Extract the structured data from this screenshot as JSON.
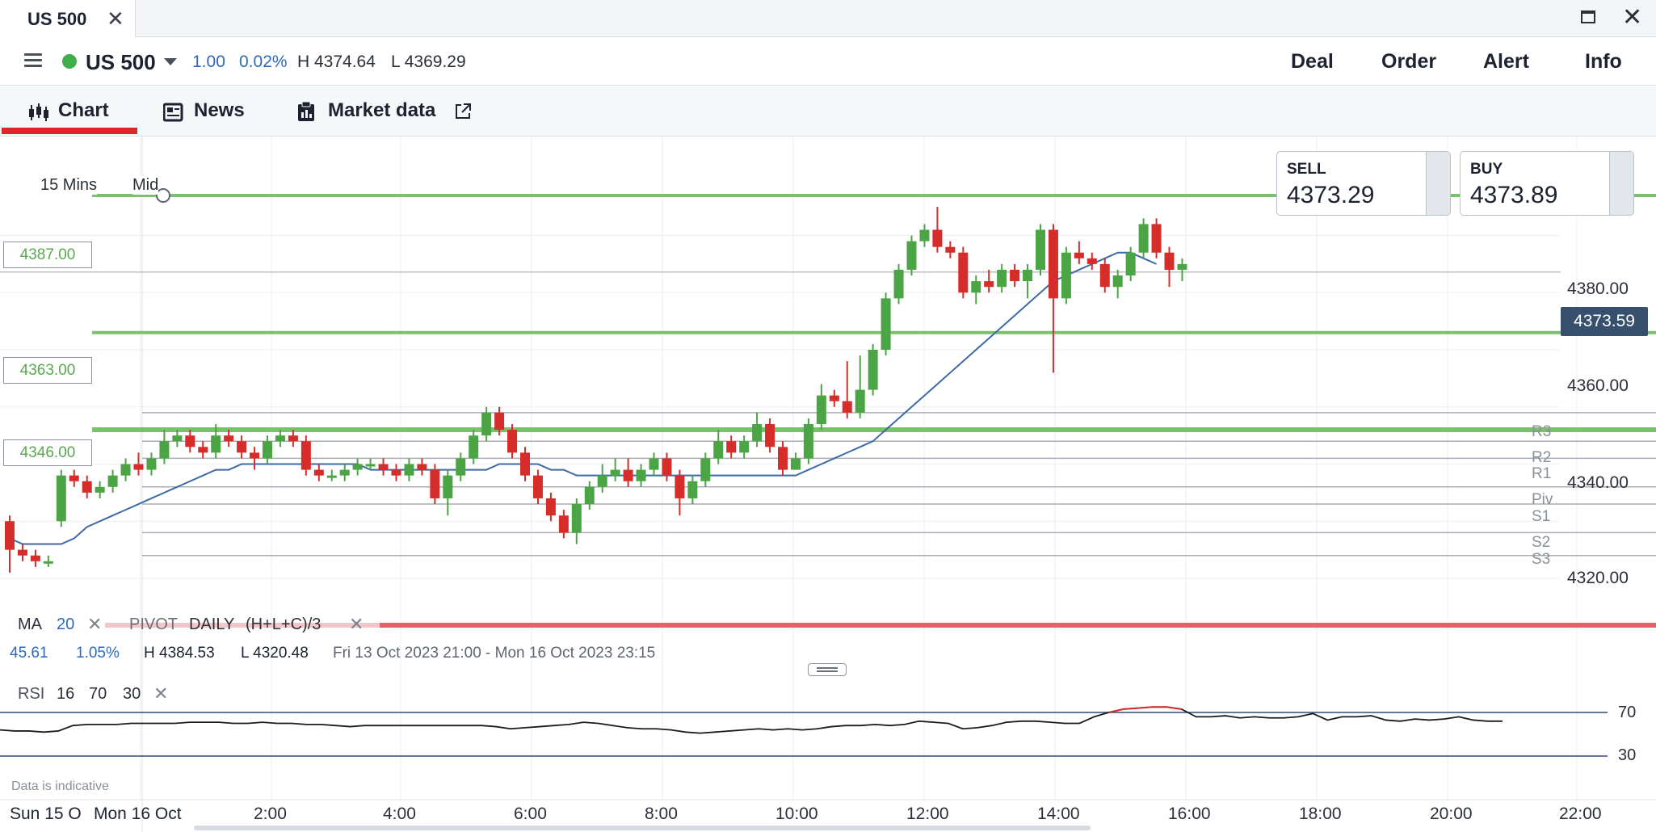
{
  "window": {
    "tab_title": "US 500",
    "close_glyph": "✕",
    "maximize_icon": "maximize-icon",
    "window_close_glyph": "✕"
  },
  "instrument": {
    "name": "US 500",
    "status_color": "#3fae49",
    "change_abs": "1.00",
    "change_pct": "0.02%",
    "high": "H 4374.64",
    "low": "L 4369.29",
    "buttons": [
      "Deal",
      "Order",
      "Alert",
      "Info"
    ]
  },
  "tabs": {
    "chart": "Chart",
    "news": "News",
    "market_data": "Market data",
    "active": "Chart",
    "accent_color": "#e0262c"
  },
  "chart": {
    "timeframe": "15 Mins",
    "price_type": "Mid",
    "sell": {
      "label": "SELL",
      "price": "4373.29"
    },
    "buy": {
      "label": "BUY",
      "price": "4373.89"
    },
    "current_price": "4373.59",
    "horizontal_levels": [
      "4387.00",
      "4363.00",
      "4346.00"
    ],
    "pivot_labels": [
      "R3",
      "R2",
      "R1",
      "Piv",
      "S1",
      "S2",
      "S3"
    ],
    "y_axis_labels": [
      "4380.00",
      "4360.00",
      "4340.00",
      "4320.00"
    ],
    "x_axis_labels": [
      "2:00",
      "4:00",
      "6:00",
      "8:00",
      "10:00",
      "12:00",
      "14:00",
      "16:00",
      "18:00",
      "20:00",
      "22:00"
    ],
    "date_labels": [
      "Sun 15 O",
      "Mon 16 Oct"
    ],
    "colors": {
      "up": "#4ca545",
      "down": "#d62d2a",
      "ma": "#3d6aa6",
      "level": "#7cbf6f",
      "pivot": "#a9aeb6",
      "rsi": "#1c1c1c",
      "rsi_over": "#d62d2a"
    }
  },
  "indicators": {
    "ma_label": "MA",
    "ma_period": "20",
    "pivot_label": "PIVOT",
    "pivot_period": "DAILY",
    "pivot_formula": "(H+L+C)/3",
    "remove_glyph": "✕"
  },
  "stats": {
    "change_abs": "45.61",
    "change_pct": "1.05%",
    "high": "H 4384.53",
    "low": "L 4320.48",
    "range": "Fri 13 Oct 2023 21:00 - Mon 16 Oct 2023 23:15"
  },
  "rsi": {
    "label": "RSI",
    "period": "16",
    "upper": "70",
    "lower": "30",
    "axis_upper": "70",
    "axis_lower": "30"
  },
  "disclaimer": "Data is indicative",
  "chart_data": {
    "type": "candlestick",
    "title": "",
    "ylabel": "",
    "xlabel": "",
    "ylim": [
      4315,
      4392
    ],
    "y_ticks": [
      4320,
      4340,
      4360,
      4380
    ],
    "x_ticks": [
      "2:00",
      "4:00",
      "6:00",
      "8:00",
      "10:00",
      "12:00",
      "14:00",
      "16:00",
      "18:00",
      "20:00",
      "22:00"
    ],
    "grid": true,
    "candles": [
      [
        4330,
        4325,
        4331,
        4321
      ],
      [
        4325,
        4324,
        4326,
        4323
      ],
      [
        4324,
        4323,
        4325,
        4322
      ],
      [
        4323,
        4323,
        4324,
        4322
      ],
      [
        4330,
        4338,
        4339,
        4329
      ],
      [
        4338,
        4337,
        4339,
        4336
      ],
      [
        4337,
        4335,
        4338,
        4334
      ],
      [
        4335,
        4336,
        4337,
        4334
      ],
      [
        4336,
        4338,
        4339,
        4335
      ],
      [
        4338,
        4340,
        4341,
        4337
      ],
      [
        4340,
        4339,
        4342,
        4338
      ],
      [
        4339,
        4341,
        4342,
        4338
      ],
      [
        4341,
        4344,
        4346,
        4340
      ],
      [
        4344,
        4345,
        4346,
        4343
      ],
      [
        4345,
        4343,
        4346,
        4342
      ],
      [
        4343,
        4342,
        4344,
        4341
      ],
      [
        4342,
        4345,
        4347,
        4341
      ],
      [
        4345,
        4344,
        4346,
        4343
      ],
      [
        4344,
        4342,
        4345,
        4341
      ],
      [
        4342,
        4341,
        4343,
        4339
      ],
      [
        4341,
        4344,
        4345,
        4340
      ],
      [
        4344,
        4345,
        4346,
        4343
      ],
      [
        4345,
        4344,
        4346,
        4343
      ],
      [
        4344,
        4339,
        4345,
        4338
      ],
      [
        4339,
        4338,
        4340,
        4337
      ],
      [
        4338,
        4338,
        4339,
        4337
      ],
      [
        4338,
        4339,
        4340,
        4337
      ],
      [
        4339,
        4340,
        4341,
        4338
      ],
      [
        4340,
        4340,
        4341,
        4339
      ],
      [
        4340,
        4339,
        4341,
        4338
      ],
      [
        4339,
        4338,
        4340,
        4337
      ],
      [
        4338,
        4340,
        4341,
        4337
      ],
      [
        4340,
        4339,
        4341,
        4338
      ],
      [
        4339,
        4334,
        4340,
        4333
      ],
      [
        4334,
        4338,
        4339,
        4331
      ],
      [
        4338,
        4341,
        4342,
        4337
      ],
      [
        4341,
        4345,
        4346,
        4340
      ],
      [
        4345,
        4349,
        4350,
        4344
      ],
      [
        4349,
        4346,
        4350,
        4345
      ],
      [
        4346,
        4342,
        4347,
        4341
      ],
      [
        4342,
        4338,
        4343,
        4337
      ],
      [
        4338,
        4334,
        4339,
        4333
      ],
      [
        4334,
        4331,
        4335,
        4330
      ],
      [
        4331,
        4328,
        4332,
        4327
      ],
      [
        4328,
        4333,
        4334,
        4326
      ],
      [
        4333,
        4336,
        4337,
        4332
      ],
      [
        4336,
        4338,
        4340,
        4335
      ],
      [
        4338,
        4339,
        4341,
        4337
      ],
      [
        4339,
        4337,
        4341,
        4336
      ],
      [
        4337,
        4339,
        4340,
        4336
      ],
      [
        4339,
        4341,
        4342,
        4338
      ],
      [
        4341,
        4338,
        4342,
        4337
      ],
      [
        4338,
        4334,
        4339,
        4331
      ],
      [
        4334,
        4337,
        4338,
        4333
      ],
      [
        4337,
        4341,
        4342,
        4336
      ],
      [
        4341,
        4344,
        4346,
        4340
      ],
      [
        4344,
        4342,
        4345,
        4341
      ],
      [
        4342,
        4344,
        4345,
        4341
      ],
      [
        4344,
        4347,
        4349,
        4343
      ],
      [
        4347,
        4343,
        4348,
        4342
      ],
      [
        4343,
        4339,
        4344,
        4338
      ],
      [
        4339,
        4341,
        4342,
        4340
      ],
      [
        4341,
        4347,
        4348,
        4340
      ],
      [
        4347,
        4352,
        4354,
        4346
      ],
      [
        4352,
        4351,
        4353,
        4350
      ],
      [
        4351,
        4349,
        4358,
        4348
      ],
      [
        4349,
        4353,
        4359,
        4348
      ],
      [
        4353,
        4360,
        4361,
        4352
      ],
      [
        4360,
        4369,
        4370,
        4359
      ],
      [
        4369,
        4374,
        4375,
        4368
      ],
      [
        4374,
        4379,
        4380,
        4373
      ],
      [
        4379,
        4381,
        4382,
        4378
      ],
      [
        4381,
        4378,
        4385,
        4377
      ],
      [
        4378,
        4377,
        4379,
        4376
      ],
      [
        4377,
        4370,
        4378,
        4369
      ],
      [
        4370,
        4372,
        4373,
        4368
      ],
      [
        4372,
        4371,
        4374,
        4370
      ],
      [
        4371,
        4374,
        4375,
        4370
      ],
      [
        4374,
        4372,
        4375,
        4371
      ],
      [
        4372,
        4374,
        4375,
        4369
      ],
      [
        4374,
        4381,
        4382,
        4373
      ],
      [
        4381,
        4369,
        4382,
        4356
      ],
      [
        4369,
        4377,
        4378,
        4368
      ],
      [
        4377,
        4376,
        4379,
        4375
      ],
      [
        4376,
        4375,
        4377,
        4374
      ],
      [
        4375,
        4371,
        4376,
        4370
      ],
      [
        4371,
        4373,
        4374,
        4369
      ],
      [
        4373,
        4377,
        4378,
        4372
      ],
      [
        4377,
        4382,
        4383,
        4376
      ],
      [
        4382,
        4377,
        4383,
        4376
      ],
      [
        4377,
        4374,
        4378,
        4371
      ],
      [
        4374,
        4375,
        4376,
        4372
      ]
    ],
    "ma20": [
      4327,
      4326,
      4326,
      4326,
      4326,
      4327,
      4329,
      4330,
      4331,
      4332,
      4333,
      4334,
      4335,
      4336,
      4337,
      4338,
      4339,
      4339,
      4340,
      4340,
      4340,
      4340,
      4340,
      4340,
      4340,
      4340,
      4340,
      4340,
      4339,
      4339,
      4339,
      4339,
      4339,
      4339,
      4339,
      4339,
      4339,
      4339,
      4340,
      4340,
      4340,
      4340,
      4339,
      4339,
      4338,
      4338,
      4338,
      4338,
      4338,
      4338,
      4338,
      4338,
      4338,
      4338,
      4338,
      4338,
      4338,
      4338,
      4338,
      4338,
      4338,
      4338,
      4339,
      4340,
      4341,
      4342,
      4343,
      4344,
      4346,
      4348,
      4350,
      4352,
      4354,
      4356,
      4358,
      4360,
      4362,
      4364,
      4366,
      4368,
      4370,
      4372,
      4373,
      4374,
      4375,
      4376,
      4377,
      4377,
      4376,
      4375
    ],
    "pivots": {
      "R3": 4349,
      "R2": 4344,
      "R1": 4341,
      "Piv": 4336,
      "S1": 4333,
      "S2": 4328,
      "S3": 4324
    },
    "levels": [
      4387,
      4363,
      4346
    ],
    "rsi": [
      54,
      53,
      53,
      52,
      53,
      58,
      59,
      59,
      59,
      60,
      60,
      60,
      60,
      61,
      61,
      61,
      60,
      60,
      61,
      60,
      60,
      59,
      59,
      58,
      57,
      58,
      58,
      58,
      58,
      58,
      58,
      58,
      58,
      58,
      57,
      55,
      56,
      57,
      58,
      59,
      61,
      60,
      58,
      56,
      55,
      55,
      54,
      52,
      51,
      52,
      53,
      54,
      55,
      54,
      55,
      54,
      55,
      57,
      58,
      58,
      59,
      58,
      59,
      62,
      61,
      60,
      55,
      56,
      58,
      61,
      62,
      62,
      61,
      60,
      60,
      66,
      70,
      73,
      74,
      75,
      75,
      73,
      66,
      66,
      67,
      65,
      66,
      65,
      65,
      66,
      69,
      63,
      66,
      66,
      67,
      63,
      62,
      64,
      63,
      64,
      66,
      63,
      62,
      62
    ],
    "rsi_upper": 70,
    "rsi_lower": 30
  }
}
